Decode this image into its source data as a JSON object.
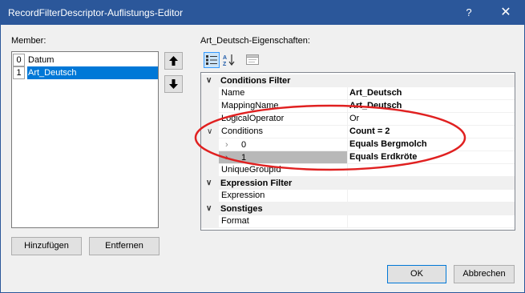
{
  "window": {
    "title": "RecordFilterDescriptor-Auflistungs-Editor",
    "help_label": "?",
    "close_label": "✕"
  },
  "members": {
    "label": "Member:",
    "items": [
      {
        "index": "0",
        "name": "Datum",
        "selected": false
      },
      {
        "index": "1",
        "name": "Art_Deutsch",
        "selected": true
      }
    ],
    "up_label": "🠑",
    "down_label": "🠓",
    "add_label": "Hinzufügen",
    "remove_label": "Entfernen"
  },
  "properties": {
    "label": "Art_Deutsch-Eigenschaften:",
    "toolbar": {
      "categorized_icon": "categorized-icon",
      "alphabetical_icon": "alphabetical-icon",
      "property_pages_icon": "property-pages-icon"
    },
    "categories": [
      {
        "label": "Conditions Filter"
      },
      {
        "label": "Expression Filter"
      },
      {
        "label": "Sonstiges"
      }
    ],
    "rows": {
      "name": {
        "name": "Name",
        "value": "Art_Deutsch"
      },
      "mapping": {
        "name": "MappingName",
        "value": "Art_Deutsch"
      },
      "logical": {
        "name": "LogicalOperator",
        "value": "Or"
      },
      "conditions": {
        "name": "Conditions",
        "value": "Count = 2"
      },
      "cond0": {
        "name": "0",
        "value": "Equals Bergmolch"
      },
      "cond1": {
        "name": "1",
        "value": "Equals Erdkröte"
      },
      "unique": {
        "name": "UniqueGroupId",
        "value": ""
      },
      "expression": {
        "name": "Expression",
        "value": ""
      },
      "format": {
        "name": "Format",
        "value": ""
      }
    },
    "annotation_color": "#e02020"
  },
  "footer": {
    "ok_label": "OK",
    "cancel_label": "Abbrechen"
  }
}
